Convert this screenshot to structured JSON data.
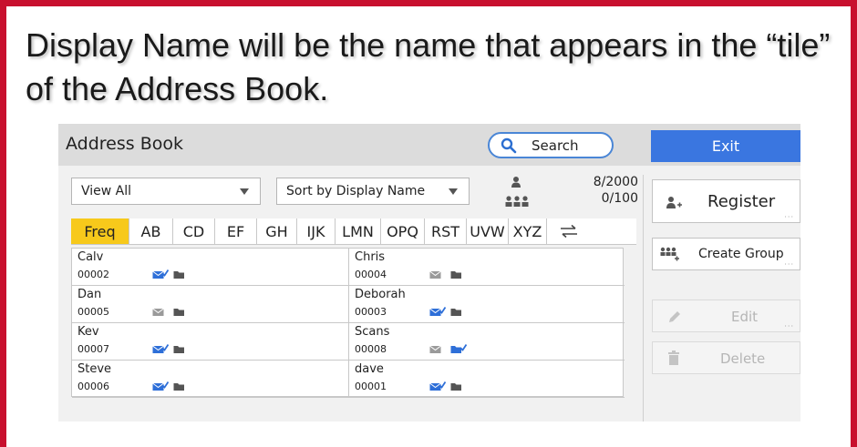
{
  "caption": "Display Name will be the name that appears in the “tile” of the Address Book.",
  "header": {
    "title": "Address Book",
    "search_label": "Search",
    "exit_label": "Exit"
  },
  "filters": {
    "view": "View All",
    "sort": "Sort by Display Name"
  },
  "counts": {
    "persons": "8/2000",
    "groups": "0/100"
  },
  "tabs": [
    "Freq",
    "AB",
    "CD",
    "EF",
    "GH",
    "IJK",
    "LMN",
    "OPQ",
    "RST",
    "UVW",
    "XYZ"
  ],
  "active_tab": "Freq",
  "entries": [
    {
      "name": "Calv",
      "number": "00002",
      "email_checked": true
    },
    {
      "name": "Chris",
      "number": "00004",
      "email_checked": false
    },
    {
      "name": "Dan",
      "number": "00005",
      "email_checked": false
    },
    {
      "name": "Deborah",
      "number": "00003",
      "email_checked": true
    },
    {
      "name": "Kev",
      "number": "00007",
      "email_checked": true
    },
    {
      "name": "Scans",
      "number": "00008",
      "email_checked": false,
      "folder_checked": true
    },
    {
      "name": "Steve",
      "number": "00006",
      "email_checked": true
    },
    {
      "name": "dave",
      "number": "00001",
      "email_checked": true
    }
  ],
  "side": {
    "register": "Register",
    "create_group": "Create Group",
    "edit": "Edit",
    "delete": "Delete"
  },
  "colors": {
    "frame": "#c8102e",
    "active_tab": "#f7c91b",
    "exit": "#3a76e0",
    "search_border": "#4a86d6",
    "checked_icon": "#2e6fd8"
  },
  "icons": [
    "search-icon",
    "person-icon",
    "group-icon",
    "switch-icon",
    "email-icon",
    "folder-icon",
    "add-person-icon",
    "add-group-icon",
    "pencil-icon",
    "trash-icon"
  ]
}
